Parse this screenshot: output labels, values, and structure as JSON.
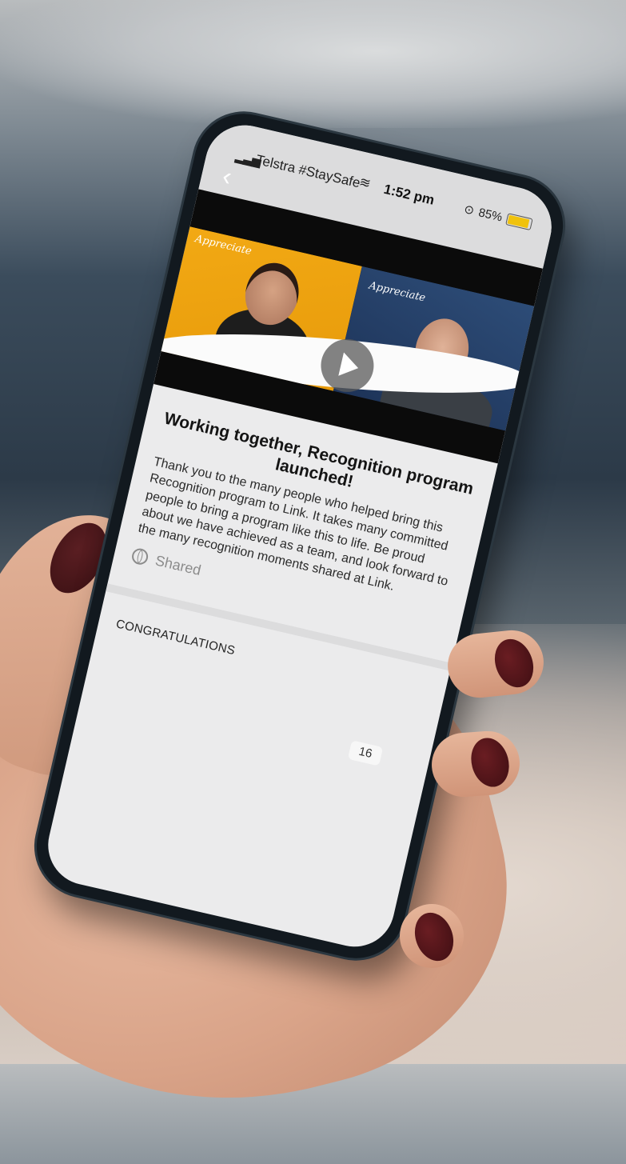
{
  "status_bar": {
    "carrier": "Telstra #StaySafe",
    "time": "1:52 pm",
    "battery": "85%",
    "battery_level": 0.85,
    "icons": [
      "signal-bars-icon",
      "wifi-icon",
      "alarm-icon",
      "battery-icon"
    ]
  },
  "navigation": {
    "back_icon": "chevron-left-icon"
  },
  "video": {
    "logo_left": "Appreciate",
    "logo_right": "Appreciate",
    "play_icon": "play-icon"
  },
  "post": {
    "title": "Working together, Recognition program launched!",
    "body": "Thank you to the many people who helped bring this Recognition program to Link.  It takes many committed people to bring a program like this to life.  Be proud about we have achieved as a team, and look forward to the many recognition moments shared at Link.",
    "visibility": "Shared",
    "visibility_icon": "globe-icon"
  },
  "congratulations": {
    "heading": "CONGRATULATIONS",
    "count": "16"
  },
  "colors": {
    "video_left_panel": "#f2a914",
    "video_right_panel": "#2d4c77",
    "battery": "#f0c20c",
    "nail_polish": "#5a1e22"
  }
}
